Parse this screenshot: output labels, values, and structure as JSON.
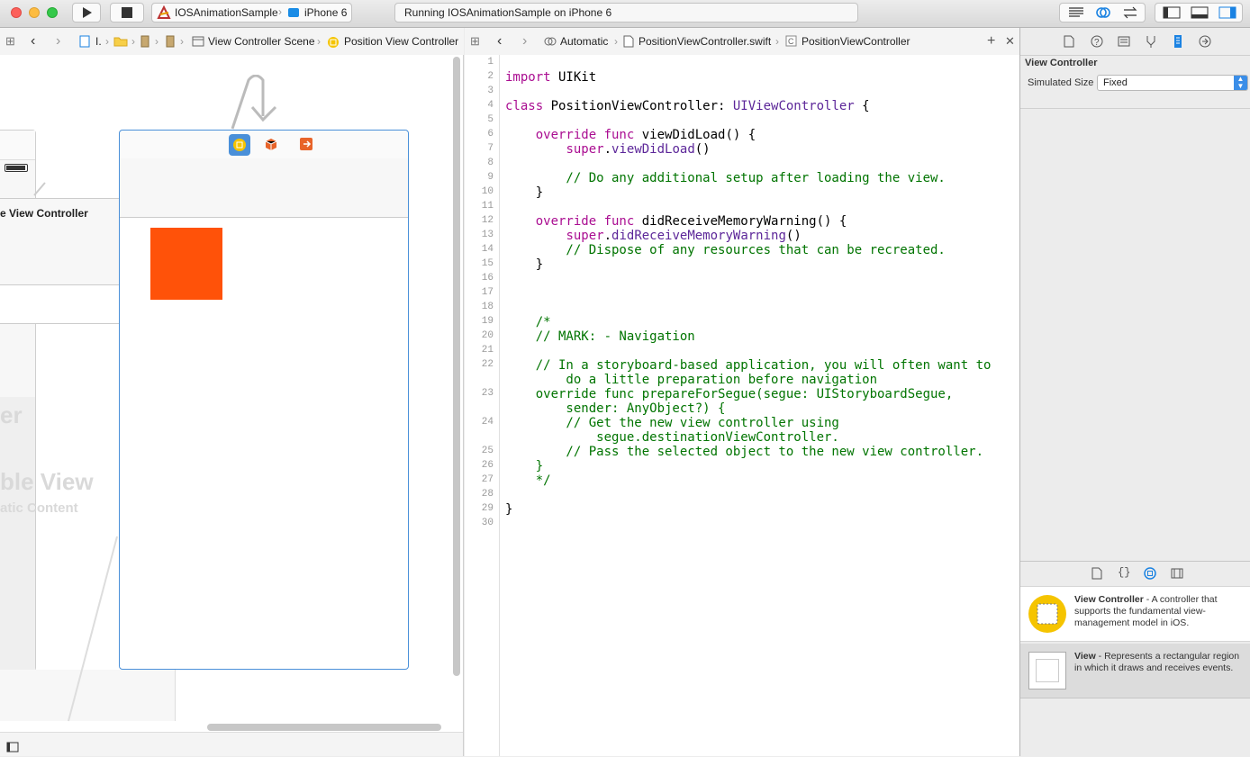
{
  "toolbar": {
    "scheme_app": "IOSAnimationSample",
    "scheme_device": "iPhone 6",
    "status_text": "Running IOSAnimationSample on iPhone 6"
  },
  "canvas_bar": {
    "crumb_1": "I.",
    "crumb_scene": "View Controller Scene",
    "crumb_vc": "Position View Controller"
  },
  "editor_bar": {
    "mode": "Automatic",
    "file": "PositionViewController.swift",
    "symbol": "PositionViewController"
  },
  "canvas": {
    "left_scene_title": "e View Controller",
    "left_large_1": "er",
    "left_large_2": "ble View",
    "left_large_3": "atic Content",
    "box_color": "#ff5209"
  },
  "code_lines": [
    {
      "n": "1",
      "segs": []
    },
    {
      "n": "2",
      "segs": [
        [
          "kw",
          "import"
        ],
        [
          "pl",
          " UIKit"
        ]
      ]
    },
    {
      "n": "3",
      "segs": []
    },
    {
      "n": "4",
      "segs": [
        [
          "kw",
          "class"
        ],
        [
          "pl",
          " PositionViewController: "
        ],
        [
          "ty",
          "UIViewController"
        ],
        [
          "pl",
          " {"
        ]
      ]
    },
    {
      "n": "5",
      "segs": []
    },
    {
      "n": "6",
      "segs": [
        [
          "pl",
          "    "
        ],
        [
          "kw",
          "override func"
        ],
        [
          "pl",
          " viewDidLoad() {"
        ]
      ]
    },
    {
      "n": "7",
      "segs": [
        [
          "pl",
          "        "
        ],
        [
          "kw",
          "super"
        ],
        [
          "pl",
          "."
        ],
        [
          "ty",
          "viewDidLoad"
        ],
        [
          "pl",
          "()"
        ]
      ]
    },
    {
      "n": "8",
      "segs": []
    },
    {
      "n": "9",
      "segs": [
        [
          "cm",
          "        // Do any additional setup after loading the view."
        ]
      ]
    },
    {
      "n": "10",
      "segs": [
        [
          "pl",
          "    }"
        ]
      ]
    },
    {
      "n": "11",
      "segs": []
    },
    {
      "n": "12",
      "segs": [
        [
          "pl",
          "    "
        ],
        [
          "kw",
          "override func"
        ],
        [
          "pl",
          " didReceiveMemoryWarning() {"
        ]
      ]
    },
    {
      "n": "13",
      "segs": [
        [
          "pl",
          "        "
        ],
        [
          "kw",
          "super"
        ],
        [
          "pl",
          "."
        ],
        [
          "ty",
          "didReceiveMemoryWarning"
        ],
        [
          "pl",
          "()"
        ]
      ]
    },
    {
      "n": "14",
      "segs": [
        [
          "cm",
          "        // Dispose of any resources that can be recreated."
        ]
      ]
    },
    {
      "n": "15",
      "segs": [
        [
          "pl",
          "    }"
        ]
      ]
    },
    {
      "n": "16",
      "segs": []
    },
    {
      "n": "17",
      "segs": []
    },
    {
      "n": "18",
      "segs": []
    },
    {
      "n": "19",
      "segs": [
        [
          "cm",
          "    /*"
        ]
      ]
    },
    {
      "n": "20",
      "segs": [
        [
          "cm",
          "    // MARK: - Navigation"
        ]
      ]
    },
    {
      "n": "21",
      "segs": []
    },
    {
      "n": "22",
      "segs": [
        [
          "cm",
          "    // In a storyboard-based application, you will often want to"
        ]
      ]
    },
    {
      "n": "",
      "segs": [
        [
          "cm",
          "        do a little preparation before navigation"
        ]
      ]
    },
    {
      "n": "23",
      "segs": [
        [
          "cm",
          "    override func prepareForSegue(segue: UIStoryboardSegue,"
        ]
      ]
    },
    {
      "n": "",
      "segs": [
        [
          "cm",
          "        sender: AnyObject?) {"
        ]
      ]
    },
    {
      "n": "24",
      "segs": [
        [
          "cm",
          "        // Get the new view controller using"
        ]
      ]
    },
    {
      "n": "",
      "segs": [
        [
          "cm",
          "            segue.destinationViewController."
        ]
      ]
    },
    {
      "n": "25",
      "segs": [
        [
          "cm",
          "        // Pass the selected object to the new view controller."
        ]
      ]
    },
    {
      "n": "26",
      "segs": [
        [
          "cm",
          "    }"
        ]
      ]
    },
    {
      "n": "27",
      "segs": [
        [
          "cm",
          "    */"
        ]
      ]
    },
    {
      "n": "28",
      "segs": []
    },
    {
      "n": "29",
      "segs": [
        [
          "pl",
          "}"
        ]
      ]
    },
    {
      "n": "30",
      "segs": []
    }
  ],
  "inspector": {
    "section_title": "View Controller",
    "sim_size_label": "Simulated Size",
    "sim_size_value": "Fixed",
    "lib_items": [
      {
        "title": "View Controller",
        "desc": " - A controller that supports the fundamental view-management model in iOS."
      },
      {
        "title": "View",
        "desc": " - Represents a rectangular region in which it draws and receives events."
      }
    ]
  }
}
